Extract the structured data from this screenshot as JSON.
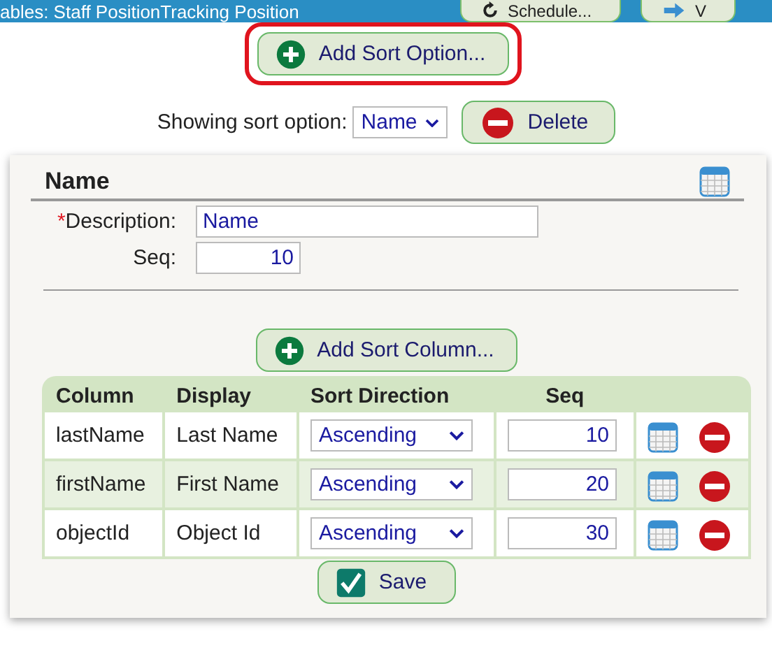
{
  "top_bar": {
    "title": "ables: Staff PositionTracking Position",
    "buttons": [
      {
        "label": "Schedule...",
        "kind": "refresh"
      },
      {
        "label": "V",
        "kind": "arrow"
      }
    ]
  },
  "add_option_button": {
    "label": "Add Sort Option...",
    "highlighted": true
  },
  "option_picker": {
    "label": "Showing sort option:",
    "value": "Name"
  },
  "delete_button": {
    "label": "Delete"
  },
  "panel": {
    "title": "Name",
    "fields": [
      {
        "required_mark": "*",
        "label": "Description:",
        "value": "Name"
      },
      {
        "label": "Seq:",
        "value": "10"
      }
    ],
    "add_column_button": {
      "label": "Add Sort Column..."
    },
    "table": {
      "columns": [
        "Column",
        "Display",
        "Sort Direction",
        "Seq"
      ],
      "rows": [
        {
          "column": "lastName",
          "display": "Last Name",
          "direction": "Ascending",
          "seq": "10"
        },
        {
          "column": "firstName",
          "display": "First Name",
          "direction": "Ascending",
          "seq": "20"
        },
        {
          "column": "objectId",
          "display": "Object Id",
          "direction": "Ascending",
          "seq": "30"
        }
      ]
    },
    "save_button": {
      "label": "Save"
    }
  }
}
